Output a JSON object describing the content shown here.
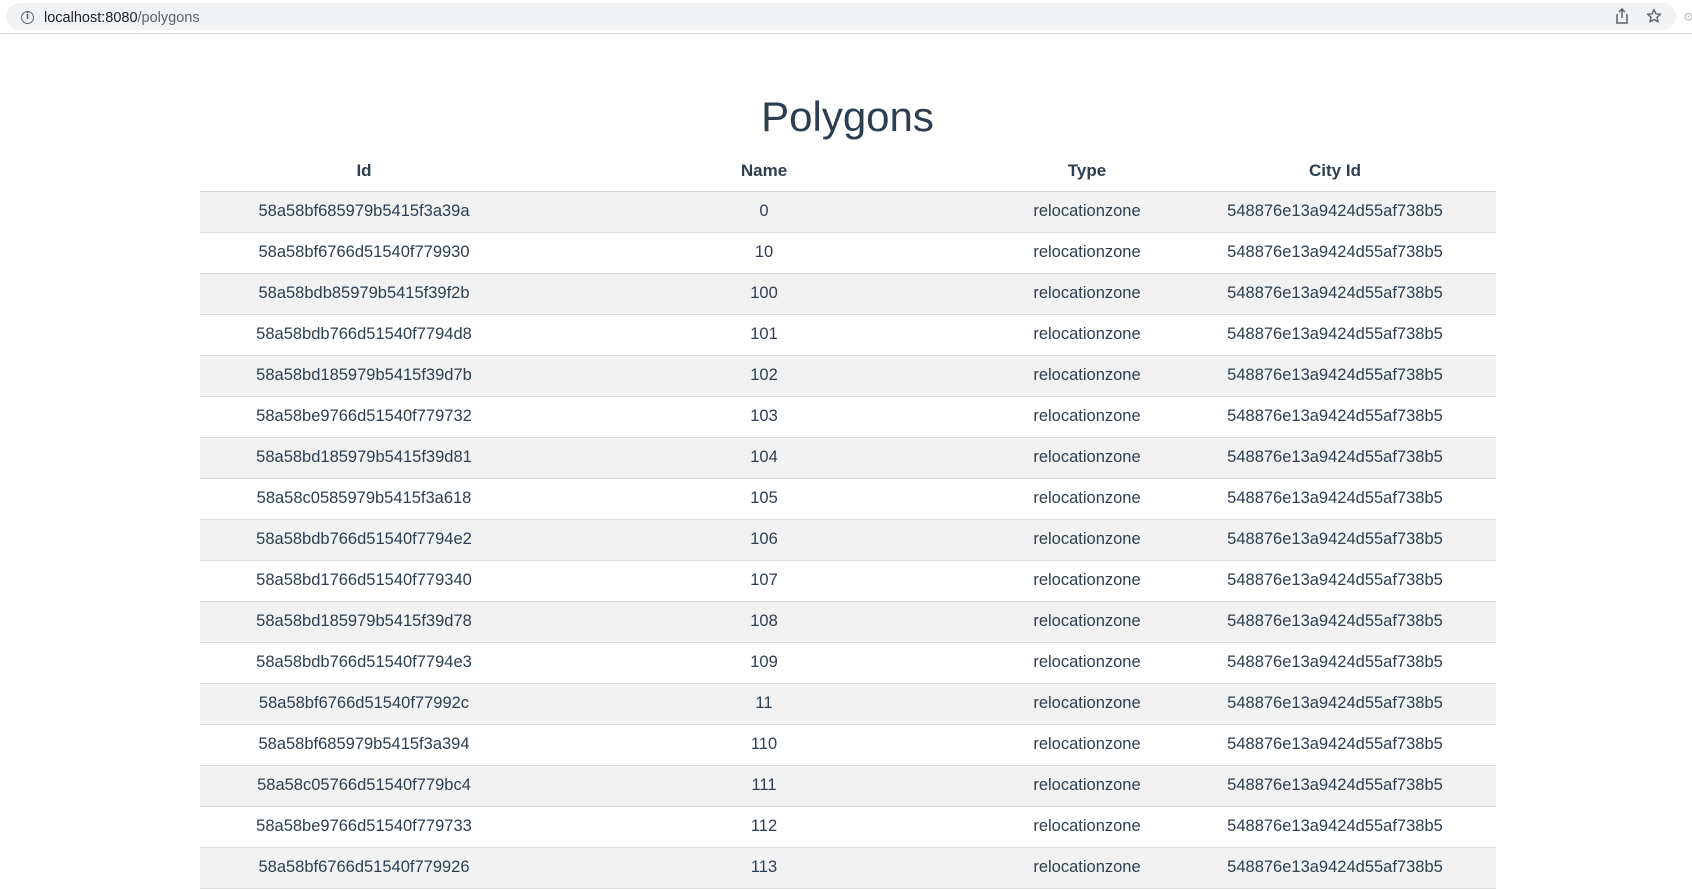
{
  "browser": {
    "url_host": "localhost:8080",
    "url_path": "/polygons"
  },
  "page": {
    "title": "Polygons"
  },
  "table": {
    "headers": {
      "id": "Id",
      "name": "Name",
      "type": "Type",
      "city_id": "City Id"
    },
    "rows": [
      {
        "id": "58a58bf685979b5415f3a39a",
        "name": "0",
        "type": "relocationzone",
        "city_id": "548876e13a9424d55af738b5"
      },
      {
        "id": "58a58bf6766d51540f779930",
        "name": "10",
        "type": "relocationzone",
        "city_id": "548876e13a9424d55af738b5"
      },
      {
        "id": "58a58bdb85979b5415f39f2b",
        "name": "100",
        "type": "relocationzone",
        "city_id": "548876e13a9424d55af738b5"
      },
      {
        "id": "58a58bdb766d51540f7794d8",
        "name": "101",
        "type": "relocationzone",
        "city_id": "548876e13a9424d55af738b5"
      },
      {
        "id": "58a58bd185979b5415f39d7b",
        "name": "102",
        "type": "relocationzone",
        "city_id": "548876e13a9424d55af738b5"
      },
      {
        "id": "58a58be9766d51540f779732",
        "name": "103",
        "type": "relocationzone",
        "city_id": "548876e13a9424d55af738b5"
      },
      {
        "id": "58a58bd185979b5415f39d81",
        "name": "104",
        "type": "relocationzone",
        "city_id": "548876e13a9424d55af738b5"
      },
      {
        "id": "58a58c0585979b5415f3a618",
        "name": "105",
        "type": "relocationzone",
        "city_id": "548876e13a9424d55af738b5"
      },
      {
        "id": "58a58bdb766d51540f7794e2",
        "name": "106",
        "type": "relocationzone",
        "city_id": "548876e13a9424d55af738b5"
      },
      {
        "id": "58a58bd1766d51540f779340",
        "name": "107",
        "type": "relocationzone",
        "city_id": "548876e13a9424d55af738b5"
      },
      {
        "id": "58a58bd185979b5415f39d78",
        "name": "108",
        "type": "relocationzone",
        "city_id": "548876e13a9424d55af738b5"
      },
      {
        "id": "58a58bdb766d51540f7794e3",
        "name": "109",
        "type": "relocationzone",
        "city_id": "548876e13a9424d55af738b5"
      },
      {
        "id": "58a58bf6766d51540f77992c",
        "name": "11",
        "type": "relocationzone",
        "city_id": "548876e13a9424d55af738b5"
      },
      {
        "id": "58a58bf685979b5415f3a394",
        "name": "110",
        "type": "relocationzone",
        "city_id": "548876e13a9424d55af738b5"
      },
      {
        "id": "58a58c05766d51540f779bc4",
        "name": "111",
        "type": "relocationzone",
        "city_id": "548876e13a9424d55af738b5"
      },
      {
        "id": "58a58be9766d51540f779733",
        "name": "112",
        "type": "relocationzone",
        "city_id": "548876e13a9424d55af738b5"
      },
      {
        "id": "58a58bf6766d51540f779926",
        "name": "113",
        "type": "relocationzone",
        "city_id": "548876e13a9424d55af738b5"
      }
    ]
  }
}
